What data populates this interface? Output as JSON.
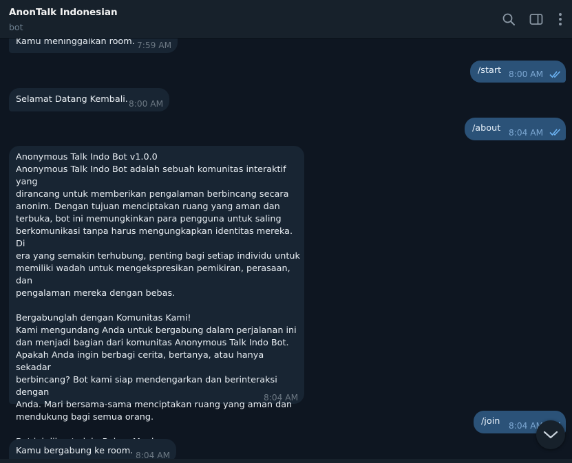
{
  "header": {
    "title": "AnonTalk Indonesian",
    "subtitle": "bot",
    "icons": [
      "search-icon",
      "sidebar-toggle-icon",
      "more-vertical-icon"
    ]
  },
  "colors": {
    "background": "#0e1621",
    "incoming_bubble": "#182533",
    "outgoing_bubble": "#2b5278",
    "header": "#17212b",
    "read_check": "#6cb3f3"
  },
  "messages": [
    {
      "direction": "in",
      "text": "Kamu meninggalkan room.",
      "time": "7:59 AM"
    },
    {
      "direction": "out",
      "text": "/start",
      "time": "8:00 AM",
      "status": "read"
    },
    {
      "direction": "in",
      "text": "Selamat Datang Kembali.",
      "time": "8:00 AM"
    },
    {
      "direction": "out",
      "text": "/about",
      "time": "8:04 AM",
      "status": "read"
    },
    {
      "direction": "in",
      "text": "Anonymous Talk Indo Bot v1.0.0\nAnonymous Talk Indo Bot adalah sebuah komunitas interaktif yang\ndirancang untuk memberikan pengalaman berbincang secara\nanonim. Dengan tujuan menciptakan ruang yang aman dan\nterbuka, bot ini memungkinkan para pengguna untuk saling\nberkomunikasi tanpa harus mengungkapkan identitas mereka. Di\nera yang semakin terhubung, penting bagi setiap individu untuk\nmemiliki wadah untuk mengekspresikan pemikiran, perasaan, dan\npengalaman mereka dengan bebas.\n\nBergabunglah dengan Komunitas Kami!\nKami mengundang Anda untuk bergabung dalam perjalanan ini\ndan menjadi bagian dari komunitas Anonymous Talk Indo Bot.\nApakah Anda ingin berbagi cerita, bertanya, atau hanya sekadar\nberbincang? Bot kami siap mendengarkan dan berinteraksi dengan\nAnda. Mari bersama-sama menciptakan ruang yang aman dan\nmendukung bagi semua orang.\n\nBot ini dibuat oleh: Rehan Maulana\nWebsite resmi kami: Anontalk",
      "time": "8:04 AM"
    },
    {
      "direction": "out",
      "text": "/join",
      "time": "8:04 AM",
      "status": "read"
    },
    {
      "direction": "in",
      "text": "Kamu bergabung ke room.",
      "time": "8:04 AM"
    }
  ]
}
